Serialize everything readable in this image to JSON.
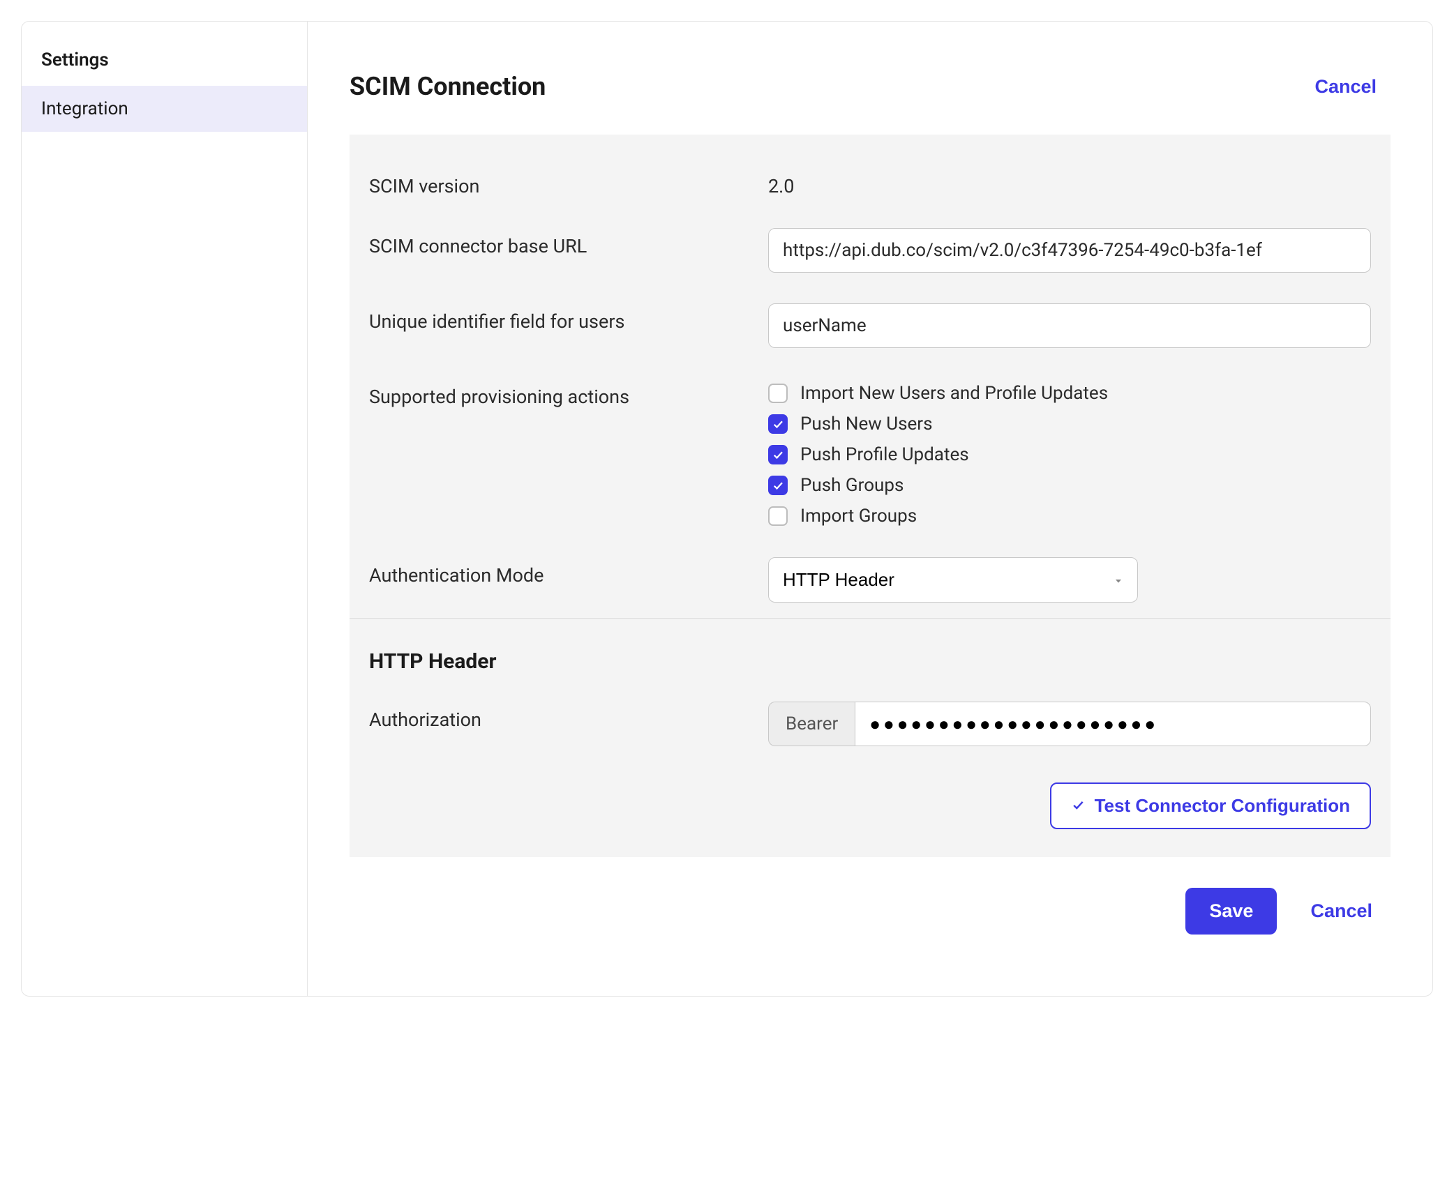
{
  "sidebar": {
    "heading": "Settings",
    "items": [
      {
        "label": "Integration",
        "selected": true
      }
    ]
  },
  "header": {
    "title": "SCIM Connection",
    "cancel": "Cancel"
  },
  "form": {
    "scim_version": {
      "label": "SCIM version",
      "value": "2.0"
    },
    "base_url": {
      "label": "SCIM connector base URL",
      "value": "https://api.dub.co/scim/v2.0/c3f47396-7254-49c0-b3fa-1ef"
    },
    "unique_id": {
      "label": "Unique identifier field for users",
      "value": "userName"
    },
    "provisioning": {
      "label": "Supported provisioning actions",
      "options": [
        {
          "label": "Import New Users and Profile Updates",
          "checked": false
        },
        {
          "label": "Push New Users",
          "checked": true
        },
        {
          "label": "Push Profile Updates",
          "checked": true
        },
        {
          "label": "Push Groups",
          "checked": true
        },
        {
          "label": "Import Groups",
          "checked": false
        }
      ]
    },
    "auth_mode": {
      "label": "Authentication Mode",
      "value": "HTTP Header"
    }
  },
  "http_header": {
    "heading": "HTTP Header",
    "authorization": {
      "label": "Authorization",
      "prefix": "Bearer",
      "value": "●●●●●●●●●●●●●●●●●●●●●"
    },
    "test_button": "Test Connector Configuration"
  },
  "footer": {
    "save": "Save",
    "cancel": "Cancel"
  }
}
